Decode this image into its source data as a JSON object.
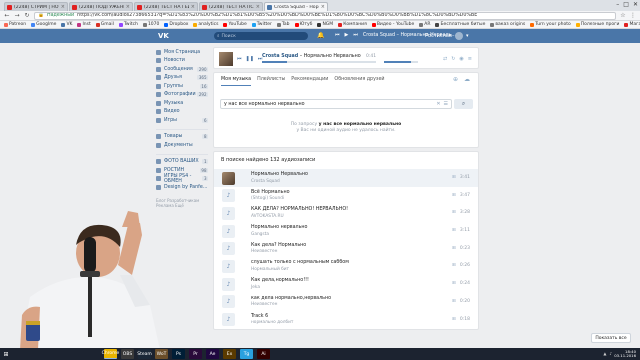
{
  "browser": {
    "tabs": [
      {
        "title": "(2248) СТРИМ | НОЧНАЯ",
        "favicon_color": "#e02020",
        "active": false
      },
      {
        "title": "(2248) ПОДГУЖЕНЬЕ",
        "favicon_color": "#e02020",
        "active": false
      },
      {
        "title": "(2248) ТЕСТ НА ГЕЙ",
        "favicon_color": "#e02020",
        "active": false
      },
      {
        "title": "(2248) ТЕСТ НА ПСИХИ",
        "favicon_color": "#e02020",
        "active": false
      },
      {
        "title": "Crosta Squad - Норма",
        "favicon_color": "#4a76a8",
        "active": true
      }
    ],
    "url": "https://vk.com/audios273866531?q=%D1%83%20%D0%B2%D1%81%D0%B5%20%D0%BD%D0%BE%D1%80%D0%BC%D0%B0%D0%BB%D1%8C%D0%BD%D0%BE",
    "secure_label": "Надежный",
    "bookmarks": [
      {
        "label": "Patreon",
        "color": "#f96854"
      },
      {
        "label": "Googlme",
        "color": "#4285f4"
      },
      {
        "label": "VK",
        "color": "#4a76a8"
      },
      {
        "label": "Inst",
        "color": "#c13584"
      },
      {
        "label": "Gmail",
        "color": "#d93025"
      },
      {
        "label": "Twitch",
        "color": "#9146ff"
      },
      {
        "label": "1070",
        "color": "#777777"
      },
      {
        "label": "Dropbox",
        "color": "#0061ff"
      },
      {
        "label": "analytics",
        "color": "#f9ab00"
      },
      {
        "label": "YouTube",
        "color": "#ff0000"
      },
      {
        "label": "Twitter",
        "color": "#1da1f2"
      },
      {
        "label": "Tab",
        "color": "#777777"
      },
      {
        "label": "Ютуб",
        "color": "#ff0000"
      },
      {
        "label": "NGM",
        "color": "#333333"
      },
      {
        "label": "Компания",
        "color": "#e02020"
      },
      {
        "label": "Видео - YouTube",
        "color": "#ff0000"
      },
      {
        "label": "AR",
        "color": "#777777"
      },
      {
        "label": "Бесплатные битые",
        "color": "#444444"
      },
      {
        "label": "ваказ origins",
        "color": "#777777"
      },
      {
        "label": "Turn your photo",
        "color": "#ff6a00"
      },
      {
        "label": "Полезные проги",
        "color": "#ffb000"
      },
      {
        "label": "Магазин 220",
        "color": "#e02020"
      },
      {
        "label": "Другие закладки",
        "color": "#ffb000"
      }
    ]
  },
  "vk_header": {
    "logo": "ВКонтакте",
    "search_placeholder": "Поиск",
    "now_playing": "Crosta Squad – Нормально Нерваль...",
    "user_name": "Ростислав"
  },
  "left_menu": {
    "items": [
      {
        "label": "Моя Страница",
        "count": ""
      },
      {
        "label": "Новости",
        "count": ""
      },
      {
        "label": "Сообщения",
        "count": "290"
      },
      {
        "label": "Друзья",
        "count": "365"
      },
      {
        "label": "Группы",
        "count": "16"
      },
      {
        "label": "Фотографии",
        "count": "292"
      },
      {
        "label": "Музыка",
        "count": ""
      },
      {
        "label": "Видео",
        "count": ""
      },
      {
        "label": "Игры",
        "count": "6"
      }
    ],
    "extra_items": [
      {
        "label": "Товары",
        "count": "8"
      },
      {
        "label": "Документы",
        "count": ""
      }
    ],
    "groups": [
      {
        "label": "ФОТО ВАШИХ",
        "count": "1"
      },
      {
        "label": "РОСТИН",
        "count": "98"
      },
      {
        "label": "ИГРЫ PS4 - ОБМЕН",
        "count": "3"
      },
      {
        "label": "Design by Panfe...",
        "count": ""
      }
    ],
    "footer": "Блог   Разработчикам   Реклама   Ещё"
  },
  "player": {
    "track_artist": "Crosta Squad",
    "track_title": "Нормально Нервально",
    "time": "0:41",
    "progress": 0.22,
    "volume": 0.8
  },
  "music": {
    "tabs": [
      "Моя музыка",
      "Плейлисты",
      "Рекомендации",
      "Обновления друзей"
    ],
    "search_value": "у нас все нормально нервально",
    "no_results_line1_prefix": "По запросу",
    "no_results_query": "у нас все нормально нервально",
    "no_results_line2": "у Вас ни одиной аудио не удалось найти."
  },
  "results": {
    "heading": "В поиске найдено 132 аудиозаписи",
    "rows": [
      {
        "title": "Нормально Нервально",
        "artist": "Crosta Squad",
        "duration": "3:41",
        "hover": true,
        "thumb": "cover"
      },
      {
        "title": "Всё Нормально",
        "artist": "(Shtogi) Soundi",
        "duration": "3:47",
        "hover": false,
        "thumb": "note"
      },
      {
        "title": "КАК ДЕЛА? НОРМАЛЬНО! НЕРВАЛЬНО!",
        "artist": "AVTOKASTA.RU",
        "duration": "3:28",
        "hover": false,
        "thumb": "note"
      },
      {
        "title": "Нормально нервально",
        "artist": "Gangsta",
        "duration": "3:11",
        "hover": false,
        "thumb": "note"
      },
      {
        "title": "Как дела? Нормально",
        "artist": "Неизвестен",
        "duration": "0:23",
        "hover": false,
        "thumb": "note"
      },
      {
        "title": "слушать только с нормальным саббом",
        "artist": "Нормальный бит",
        "duration": "0:26",
        "hover": false,
        "thumb": "note"
      },
      {
        "title": "Как дела,нормально!!!",
        "artist": "Jeka",
        "duration": "0:24",
        "hover": false,
        "thumb": "note"
      },
      {
        "title": "как дела нормально,нервально",
        "artist": "Неизвестен",
        "duration": "0:20",
        "hover": false,
        "thumb": "note"
      },
      {
        "title": "Track 6",
        "artist": "нормально долбит",
        "duration": "0:18",
        "hover": false,
        "thumb": "note"
      }
    ],
    "show_all": "Показать все"
  },
  "taskbar": {
    "apps": [
      "Chrome",
      "OBS",
      "Steam",
      "WoT",
      "Ps",
      "Pr",
      "Ae",
      "Ex",
      "Tg",
      "Ai"
    ],
    "time": "18:40",
    "date": "03.11.2016"
  },
  "colors": {
    "vk_blue": "#4a76a8",
    "vk_link": "#2a5885",
    "page_bg": "#edeef0"
  }
}
